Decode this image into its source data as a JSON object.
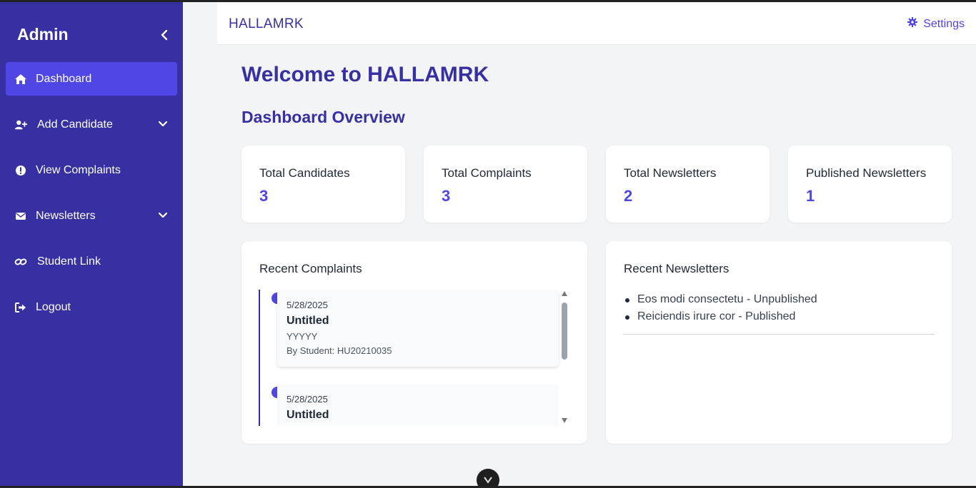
{
  "sidebar": {
    "title": "Admin",
    "items": [
      {
        "label": "Dashboard",
        "icon": "home-icon",
        "active": true
      },
      {
        "label": "Add Candidate",
        "icon": "user-plus-icon",
        "has_submenu": true
      },
      {
        "label": "View Complaints",
        "icon": "exclamation-circle-icon"
      },
      {
        "label": "Newsletters",
        "icon": "envelope-icon",
        "has_submenu": true
      },
      {
        "label": "Student Link",
        "icon": "link-icon"
      },
      {
        "label": "Logout",
        "icon": "sign-out-icon"
      }
    ]
  },
  "topbar": {
    "brand": "HALLAMRK",
    "settings_label": "Settings"
  },
  "main": {
    "welcome": "Welcome to HALLAMRK",
    "overview_title": "Dashboard Overview",
    "stats": [
      {
        "label": "Total Candidates",
        "value": "3"
      },
      {
        "label": "Total Complaints",
        "value": "3"
      },
      {
        "label": "Total Newsletters",
        "value": "2"
      },
      {
        "label": "Published Newsletters",
        "value": "1"
      }
    ],
    "recent_complaints": {
      "title": "Recent Complaints",
      "items": [
        {
          "date": "5/28/2025",
          "title": "Untitled",
          "description": "YYYYY",
          "by": "By Student: HU20210035"
        },
        {
          "date": "5/28/2025",
          "title": "Untitled"
        }
      ]
    },
    "recent_newsletters": {
      "title": "Recent Newsletters",
      "items": [
        "Eos modi consectetu - Unpublished",
        "Reiciendis irure cor - Published"
      ]
    }
  },
  "colors": {
    "sidebar_bg": "#3730a3",
    "active_item": "#4f46e5",
    "accent": "#4f46e5",
    "heading": "#3730a3"
  }
}
